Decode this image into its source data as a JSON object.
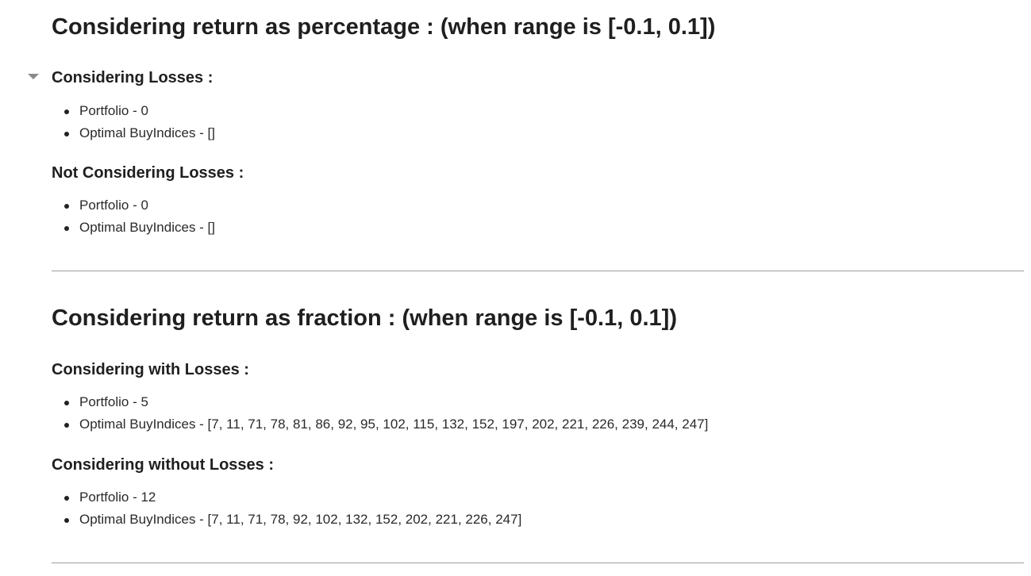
{
  "sections": [
    {
      "heading": "Considering return as percentage : (when range is [-0.1, 0.1])",
      "groups": [
        {
          "subheading": "Considering Losses :",
          "items": [
            "Portfolio - 0",
            "Optimal BuyIndices - []"
          ]
        },
        {
          "subheading": "Not Considering Losses :",
          "items": [
            "Portfolio - 0",
            "Optimal BuyIndices - []"
          ]
        }
      ]
    },
    {
      "heading": "Considering return as fraction : (when range is [-0.1, 0.1])",
      "groups": [
        {
          "subheading": "Considering with Losses :",
          "items": [
            "Portfolio - 5",
            "Optimal BuyIndices - [7, 11, 71, 78, 81, 86, 92, 95, 102, 115, 132, 152, 197, 202, 221, 226, 239, 244, 247]"
          ]
        },
        {
          "subheading": "Considering without Losses :",
          "items": [
            "Portfolio - 12",
            "Optimal BuyIndices - [7, 11, 71, 78, 92, 102, 132, 152, 202, 221, 226, 247]"
          ]
        }
      ]
    }
  ],
  "icons": {
    "collapse_toggle": "caret-down-icon"
  }
}
